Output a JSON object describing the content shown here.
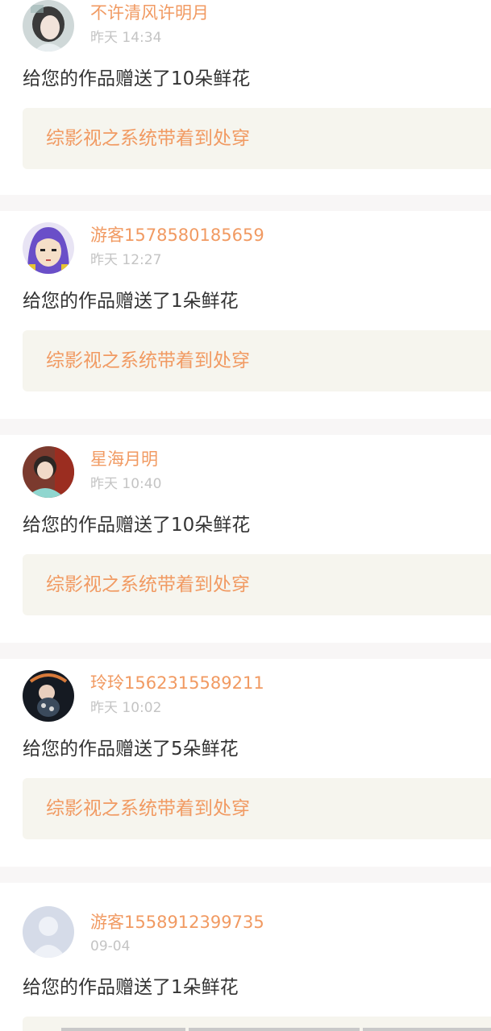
{
  "notifications": [
    {
      "username": "不许清风许明月",
      "time": "昨天 14:34",
      "message": "给您的作品赠送了10朵鲜花",
      "work_title": "综影视之系统带着到处穿",
      "avatar": "avatar-photo-woman"
    },
    {
      "username": "游客1578580185659",
      "time": "昨天 12:27",
      "message": "给您的作品赠送了1朵鲜花",
      "work_title": "综影视之系统带着到处穿",
      "avatar": "avatar-cartoon-purple-hair"
    },
    {
      "username": "星海月明",
      "time": "昨天 10:40",
      "message": "给您的作品赠送了10朵鲜花",
      "work_title": "综影视之系统带着到处穿",
      "avatar": "avatar-photo-girl"
    },
    {
      "username": "玲玲1562315589211",
      "time": "昨天 10:02",
      "message": "给您的作品赠送了5朵鲜花",
      "work_title": "综影视之系统带着到处穿",
      "avatar": "avatar-photo-baby"
    },
    {
      "username": "游客1558912399735",
      "time": "09-04",
      "message": "给您的作品赠送了1朵鲜花",
      "avatar": "avatar-default-user"
    }
  ],
  "colors": {
    "accent": "#f19a62",
    "tab_indicator": "#f07aa6",
    "timestamp": "#c4c4c4",
    "message_text": "#333333",
    "work_box_bg": "#f6f5ee",
    "separator": "#f8f6f6"
  }
}
